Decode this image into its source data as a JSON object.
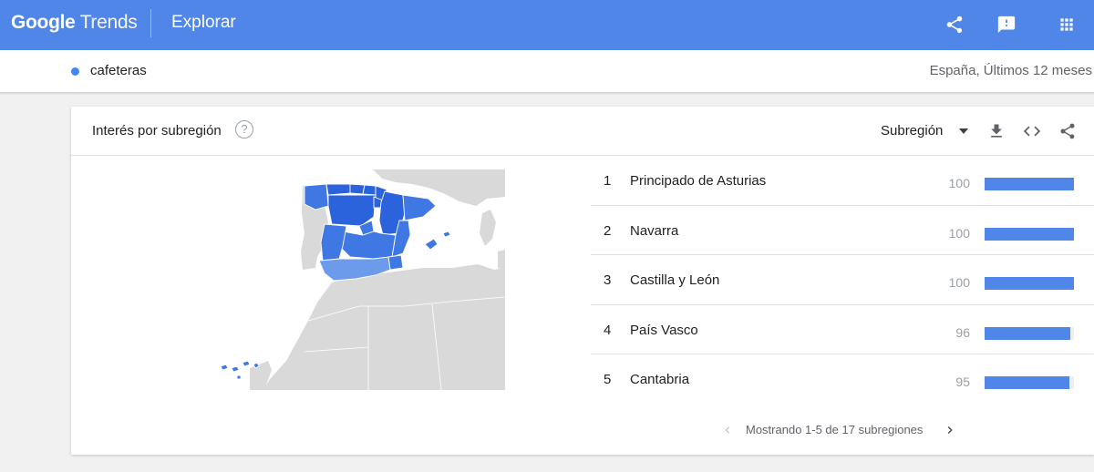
{
  "header": {
    "logo_google": "Google",
    "logo_trends": "Trends",
    "title": "Explorar",
    "icons": [
      "share-icon",
      "feedback-icon",
      "apps-icon"
    ]
  },
  "term": {
    "name": "cafeteras",
    "meta": "España, Últimos 12 meses",
    "color": "#4285f4"
  },
  "card": {
    "title": "Interés por subregión",
    "help": "?",
    "resolution": "Subregión",
    "tools": [
      "download-icon",
      "embed-icon",
      "share-icon"
    ]
  },
  "regions": [
    {
      "rank": "1",
      "name": "Principado de Asturias",
      "value": 100
    },
    {
      "rank": "2",
      "name": "Navarra",
      "value": 100
    },
    {
      "rank": "3",
      "name": "Castilla y León",
      "value": 100
    },
    {
      "rank": "4",
      "name": "País Vasco",
      "value": 96
    },
    {
      "rank": "5",
      "name": "Cantabria",
      "value": 95
    }
  ],
  "pager": {
    "text": "Mostrando 1-5 de 17 subregiones"
  },
  "colors": {
    "header": "#4f86e8",
    "bar": "#4f86e8",
    "map_high": "#2b63dc",
    "map_mid": "#3f77e3",
    "map_low": "#6d9bec",
    "land": "#d9d9d9"
  }
}
